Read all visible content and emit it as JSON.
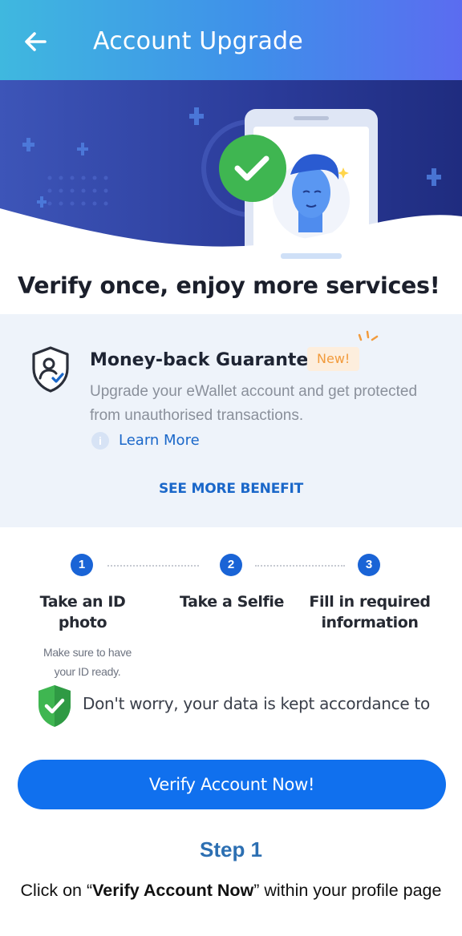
{
  "header": {
    "title": "Account Upgrade",
    "back_icon": "arrow-left-icon"
  },
  "hero": {
    "headline": "Verify once, enjoy more services!",
    "illustration": "phone-selfie-verified-illustration"
  },
  "benefit": {
    "icon": "shield-user-icon",
    "title": "Money-back Guarantee",
    "badge": "New!",
    "description": "Upgrade your eWallet account and get protected from unauthorised transactions.",
    "learn_more": "Learn More",
    "see_more": "SEE MORE BENEFIT"
  },
  "steps": [
    {
      "number": "1",
      "label_line1": "Take an ID",
      "label_line2": "photo",
      "note_line1": "Make sure to have",
      "note_line2": "your ID ready."
    },
    {
      "number": "2",
      "label_line1": "Take a Selfie",
      "label_line2": ""
    },
    {
      "number": "3",
      "label_line1": "Fill in required",
      "label_line2": "information"
    }
  ],
  "assurance": {
    "icon": "shield-check-icon",
    "text": "Don't worry, your data is kept accordance to"
  },
  "cta": {
    "label": "Verify Account Now!"
  },
  "caption": {
    "step": "Step 1",
    "text_before": "Click on “",
    "text_bold": "Verify Account Now",
    "text_after": "” within your profile page"
  },
  "colors": {
    "primary": "#1070ee",
    "header_start": "#3fb8df",
    "header_end": "#5b6cf0",
    "hero_bg": "#2d3f9c",
    "success": "#34b253",
    "caption_step": "#2c6fb2"
  }
}
